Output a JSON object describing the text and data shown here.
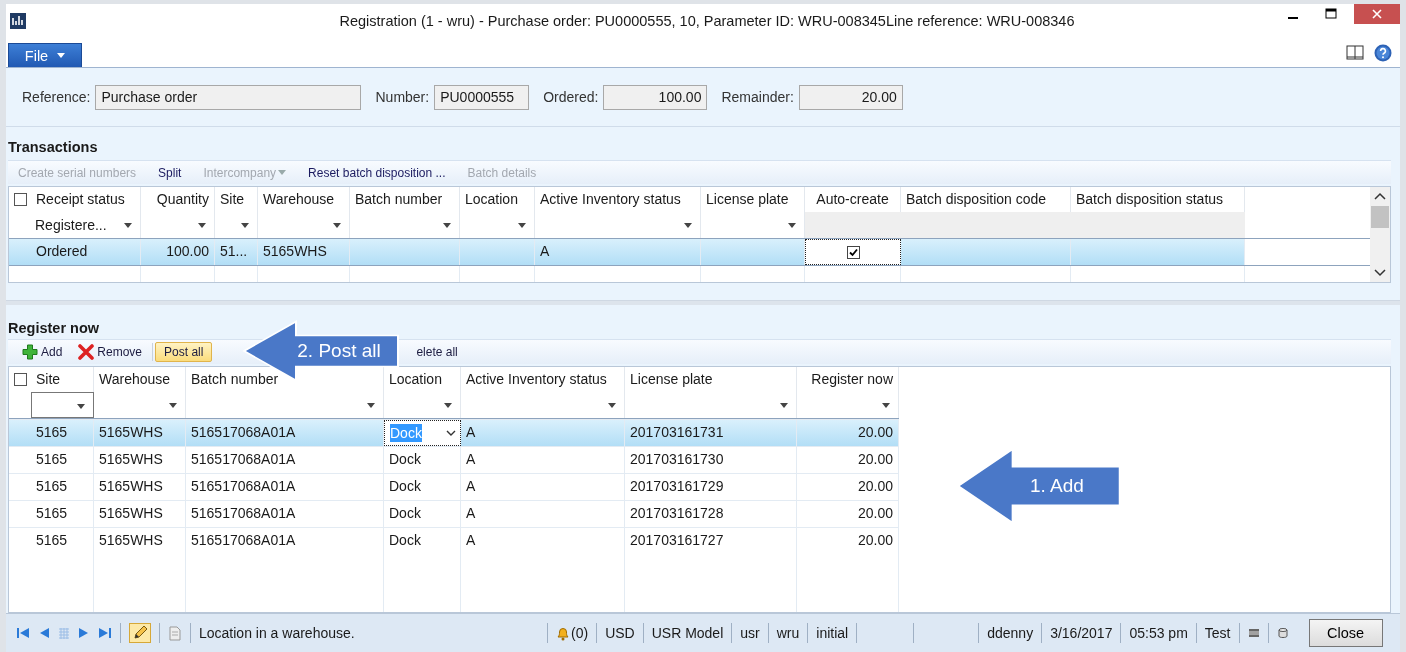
{
  "window": {
    "title": "Registration (1 - wru) - Purchase order: PU0000555, 10, Parameter ID: WRU-008345Line reference: WRU-008346"
  },
  "file_tab": {
    "label": "File"
  },
  "header_fields": [
    {
      "label": "Reference:",
      "value": "Purchase order",
      "kind": "text"
    },
    {
      "label": "Number:",
      "value": "PU0000555",
      "kind": "code"
    },
    {
      "label": "Ordered:",
      "value": "100.00",
      "kind": "number"
    },
    {
      "label": "Remainder:",
      "value": "20.00",
      "kind": "number"
    }
  ],
  "transactions": {
    "title": "Transactions",
    "all_selected": false,
    "toolbar": [
      {
        "label": "Create serial numbers",
        "disabled": true,
        "dropdown": false
      },
      {
        "label": "Split",
        "disabled": false,
        "dropdown": false
      },
      {
        "label": "Intercompany",
        "disabled": true,
        "dropdown": true
      },
      {
        "label": "Reset batch disposition ...",
        "disabled": false,
        "dropdown": false
      },
      {
        "label": "Batch details",
        "disabled": true,
        "dropdown": false
      }
    ],
    "columns": [
      {
        "label": "Receipt status",
        "kind": "text",
        "filter": true,
        "filter_value": "Registere..."
      },
      {
        "label": "Quantity",
        "kind": "number",
        "filter": true
      },
      {
        "label": "Site",
        "kind": "text",
        "filter": true
      },
      {
        "label": "Warehouse",
        "kind": "text",
        "filter": true
      },
      {
        "label": "Batch number",
        "kind": "text",
        "filter": true
      },
      {
        "label": "Location",
        "kind": "text",
        "filter": true
      },
      {
        "label": "Active Inventory status",
        "kind": "text",
        "filter": true
      },
      {
        "label": "License plate",
        "kind": "text",
        "filter": true
      },
      {
        "label": "Auto-create",
        "kind": "checkbox",
        "filter": false
      },
      {
        "label": "Batch disposition code",
        "kind": "text",
        "filter": false
      },
      {
        "label": "Batch disposition status",
        "kind": "text",
        "filter": false
      }
    ],
    "rows": [
      {
        "selected": true,
        "cells": [
          "Ordered",
          "100.00",
          "51...",
          "5165WHS",
          null,
          null,
          "A",
          null,
          true,
          null,
          null
        ]
      }
    ]
  },
  "register": {
    "title": "Register now",
    "all_selected": false,
    "toolbar": [
      {
        "label": "Add",
        "highlighted": false
      },
      {
        "label": "Remove",
        "highlighted": false
      },
      {
        "label": "Post all",
        "highlighted": true
      },
      {
        "label": "elete all",
        "highlighted": false
      }
    ],
    "columns": [
      {
        "label": "Site",
        "kind": "text"
      },
      {
        "label": "Warehouse",
        "kind": "text"
      },
      {
        "label": "Batch number",
        "kind": "text"
      },
      {
        "label": "Location",
        "kind": "text"
      },
      {
        "label": "Active Inventory status",
        "kind": "text"
      },
      {
        "label": "License plate",
        "kind": "text"
      },
      {
        "label": "Register now",
        "kind": "number"
      }
    ],
    "rows": [
      {
        "selected": true,
        "editing": true,
        "cells": [
          "5165",
          "5165WHS",
          "516517068A01A",
          "Dock",
          "A",
          "201703161731",
          "20.00"
        ]
      },
      {
        "selected": false,
        "editing": false,
        "cells": [
          "5165",
          "5165WHS",
          "516517068A01A",
          "Dock",
          "A",
          "201703161730",
          "20.00"
        ]
      },
      {
        "selected": false,
        "editing": false,
        "cells": [
          "5165",
          "5165WHS",
          "516517068A01A",
          "Dock",
          "A",
          "201703161729",
          "20.00"
        ]
      },
      {
        "selected": false,
        "editing": false,
        "cells": [
          "5165",
          "5165WHS",
          "516517068A01A",
          "Dock",
          "A",
          "201703161728",
          "20.00"
        ]
      },
      {
        "selected": false,
        "editing": false,
        "cells": [
          "5165",
          "5165WHS",
          "516517068A01A",
          "Dock",
          "A",
          "201703161727",
          "20.00"
        ]
      }
    ]
  },
  "status_bar": {
    "edit_mode": true,
    "message": "Location in a warehouse.",
    "notifications": "(0)",
    "items": [
      "USD",
      "USR Model",
      "usr",
      "wru",
      "initial"
    ],
    "user_items": [
      "ddenny",
      "3/16/2017",
      "05:53 pm",
      "Test"
    ],
    "close": "Close"
  },
  "annotations": [
    {
      "label": "2. Post all"
    },
    {
      "label": "1. Add"
    }
  ]
}
